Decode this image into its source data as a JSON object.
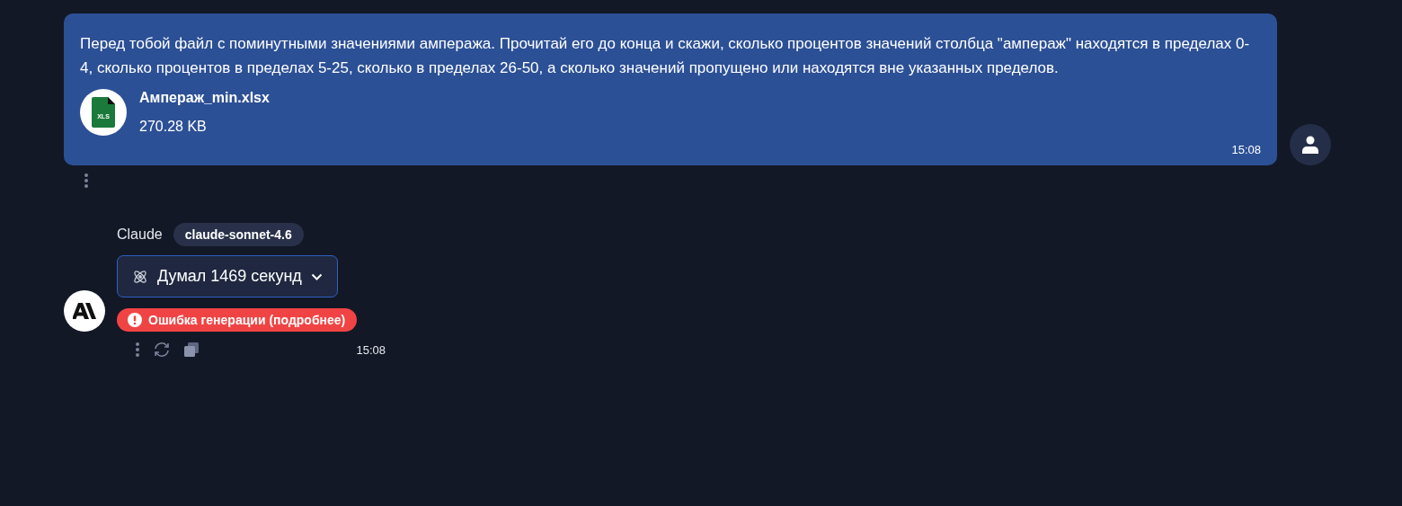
{
  "user_message": {
    "text": "Перед тобой файл с поминутными значениями ампеража. Прочитай его до конца и скажи, сколько процентов значений столбца \"ампераж\" находятся в пределах 0-4, сколько процентов в пределах 5-25, сколько в пределах 26-50, а сколько значений пропущено или находятся вне указанных пределов.",
    "attachment": {
      "name": "Ампераж_min.xlsx",
      "size": "270.28 KB",
      "file_type": "XLS"
    },
    "time": "15:08"
  },
  "assistant_message": {
    "name": "Claude",
    "model": "claude-sonnet-4.6",
    "thinking": {
      "label": "Думал 1469 секунд",
      "expanded": false
    },
    "error": "Ошибка генерации (подробнее)",
    "time": "15:08"
  }
}
